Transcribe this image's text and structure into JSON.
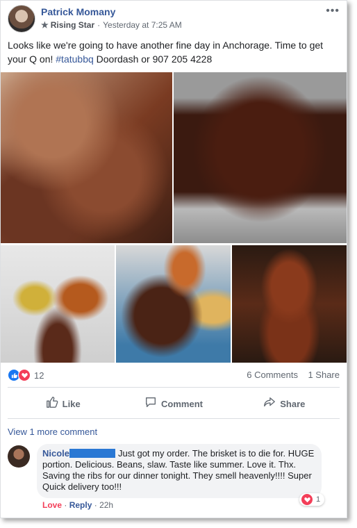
{
  "post": {
    "author": "Patrick Momany",
    "badge": "Rising Star",
    "time": "Yesterday at 7:25 AM",
    "more_label": "•••",
    "text_main": "Looks like we're going to have another fine day in Anchorage. Time to get your Q on! ",
    "hashtag": "#tatubbq",
    "text_tail": " Doordash or 907 205 4228"
  },
  "photos": [
    {
      "name": "brisket-closeup"
    },
    {
      "name": "brisket-on-grill"
    },
    {
      "name": "plate-with-beans-and-slaw"
    },
    {
      "name": "bbq-platter"
    },
    {
      "name": "ribs-in-smoker"
    }
  ],
  "stats": {
    "reaction_count": "12",
    "comments": "6 Comments",
    "shares": "1 Share"
  },
  "actions": {
    "like": "Like",
    "comment": "Comment",
    "share": "Share"
  },
  "comments": {
    "view_more": "View 1 more comment",
    "items": [
      {
        "author": "Nicole",
        "text": "Just got my order. The brisket is to die for. HUGE portion. Delicious. Beans, slaw. Taste like summer. Love it. Thx. Saving the ribs for our dinner tonight. They smell heavenly!!!! Super Quick delivery too!!!",
        "reaction_count": "1",
        "love_label": "Love",
        "reply_label": "Reply",
        "time": "22h"
      }
    ]
  },
  "icons": {
    "like": "thumbs-up-icon",
    "comment": "speech-bubble-icon",
    "share": "share-arrow-icon",
    "star": "star-icon",
    "heart": "heart-icon"
  },
  "colors": {
    "link": "#365899",
    "like_blue": "#1877f2",
    "love_red": "#f33e58"
  }
}
